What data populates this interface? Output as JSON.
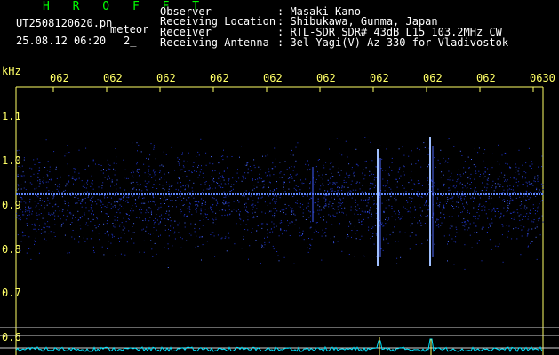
{
  "header": {
    "title": "H R O F F T",
    "filename": "UT2508120620.pn",
    "mode": "meteor",
    "datetime": "25.08.12 06:20",
    "index": "2_",
    "fields": [
      {
        "label": "Observer",
        "value": ": Masaki Kano"
      },
      {
        "label": "Receiving Location",
        "value": ": Shibukawa, Gunma, Japan"
      },
      {
        "label": "Receiver",
        "value": ": RTL-SDR SDR# 43dB L15 103.2MHz CW"
      },
      {
        "label": "Receiving Antenna",
        "value": ": 3el Yagi(V) Az 330 for Vladivostok"
      }
    ]
  },
  "axis": {
    "unit": "kHz",
    "time_ticks": [
      "062",
      "062",
      "062",
      "062",
      "062",
      "062",
      "062",
      "062",
      "062",
      "0630"
    ],
    "freq_ticks": [
      "1.1",
      "1.0",
      "0.9",
      "0.8",
      "0.7",
      "0.6"
    ]
  },
  "colors": {
    "text": "#ffffff",
    "label": "#ffff66",
    "title": "#00ff00",
    "signal": "#2a4dff",
    "carrier": "#6699ff",
    "spectrum": "#00e5ff"
  }
}
